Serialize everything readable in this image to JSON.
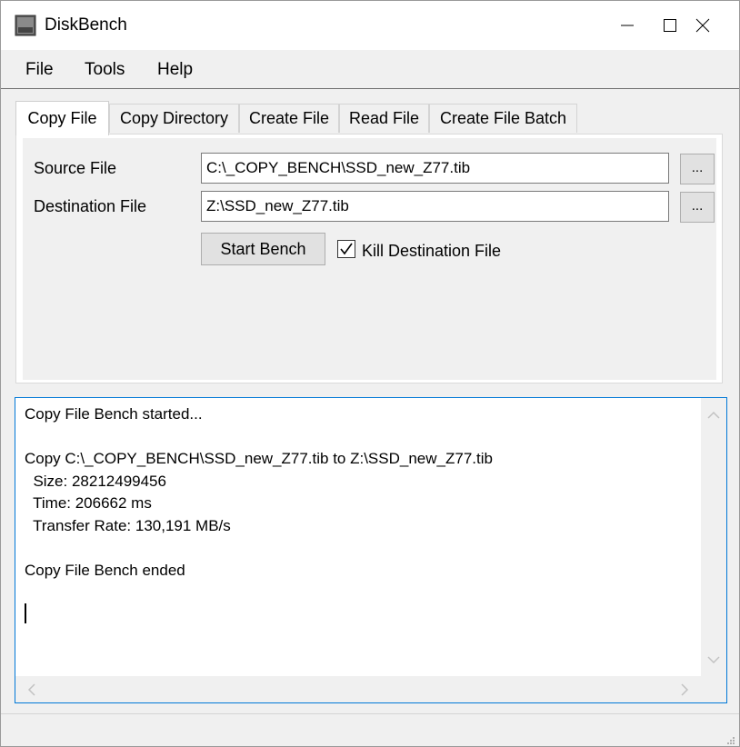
{
  "window": {
    "title": "DiskBench"
  },
  "menu": {
    "items": [
      "File",
      "Tools",
      "Help"
    ]
  },
  "tabs": [
    "Copy File",
    "Copy Directory",
    "Create File",
    "Read File",
    "Create File Batch"
  ],
  "form": {
    "source_label": "Source File",
    "source_value": "C:\\_COPY_BENCH\\SSD_new_Z77.tib",
    "dest_label": "Destination File",
    "dest_value": "Z:\\SSD_new_Z77.tib",
    "browse_label": "...",
    "start_label": "Start Bench",
    "kill_label": "Kill Destination File",
    "kill_checked": true
  },
  "log": {
    "lines": [
      "Copy File Bench started...",
      "",
      "Copy C:\\_COPY_BENCH\\SSD_new_Z77.tib to Z:\\SSD_new_Z77.tib",
      "  Size: 28212499456",
      "  Time: 206662 ms",
      "  Transfer Rate: 130,191 MB/s",
      "",
      "Copy File Bench ended"
    ]
  },
  "colors": {
    "accent": "#0078d7",
    "window_bg": "#f0f0f0"
  }
}
